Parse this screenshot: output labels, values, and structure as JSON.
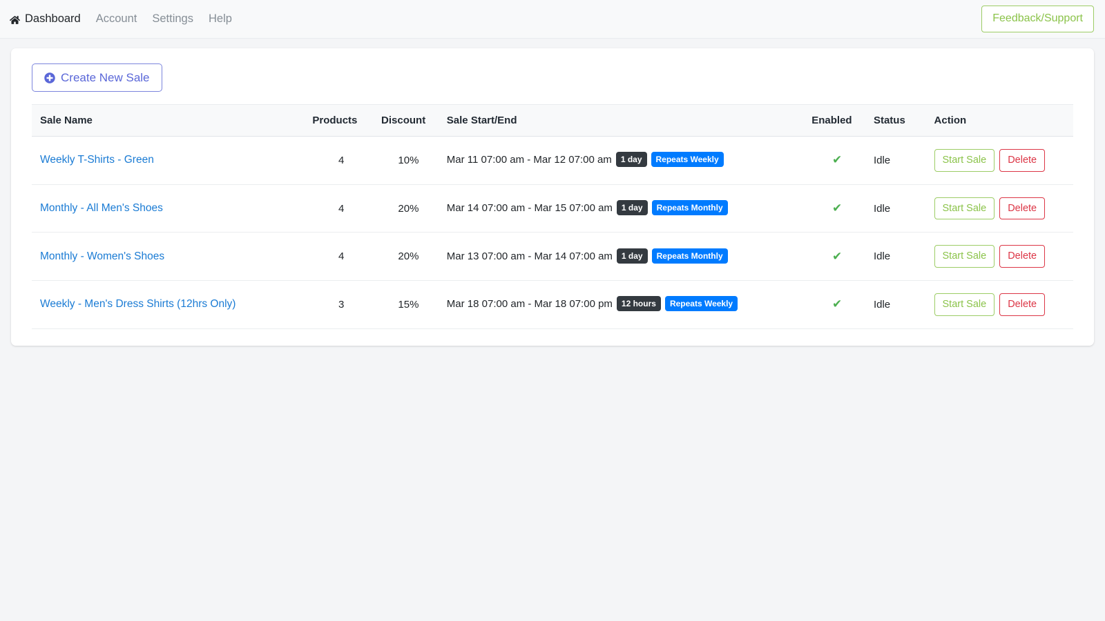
{
  "navbar": {
    "brand": {
      "icon": "home-icon",
      "label": "Dashboard"
    },
    "links": [
      {
        "label": "Account"
      },
      {
        "label": "Settings"
      },
      {
        "label": "Help"
      }
    ],
    "feedback_button": {
      "label": "Feedback/Support",
      "color": "#8bc34a"
    }
  },
  "toolbar": {
    "create_label": "Create New Sale",
    "create_icon": "plus-circle-icon",
    "create_color": "#5a67d8"
  },
  "table": {
    "headers": {
      "name": "Sale Name",
      "products": "Products",
      "discount": "Discount",
      "dates": "Sale Start/End",
      "enabled": "Enabled",
      "status": "Status",
      "action": "Action"
    },
    "row_actions": {
      "start_label": "Start Sale",
      "delete_label": "Delete",
      "start_color": "#8bc34a",
      "delete_color": "#dc3545"
    },
    "enabled_icon": "check-icon",
    "enabled_color": "#4caf50",
    "badge_colors": {
      "duration": "#343a40",
      "repeat": "#007bff"
    },
    "rows": [
      {
        "name": "Weekly T-Shirts - Green",
        "products": "4",
        "discount": "10%",
        "dates": "Mar 11 07:00 am - Mar 12 07:00 am",
        "duration_badge": "1 day",
        "repeat_badge": "Repeats Weekly",
        "enabled": "✔",
        "status": "Idle",
        "start_label": "Start Sale",
        "delete_label": "Delete"
      },
      {
        "name": "Monthly - All Men's Shoes",
        "products": "4",
        "discount": "20%",
        "dates": "Mar 14 07:00 am - Mar 15 07:00 am",
        "duration_badge": "1 day",
        "repeat_badge": "Repeats Monthly",
        "enabled": "✔",
        "status": "Idle",
        "start_label": "Start Sale",
        "delete_label": "Delete"
      },
      {
        "name": "Monthly - Women's Shoes",
        "products": "4",
        "discount": "20%",
        "dates": "Mar 13 07:00 am - Mar 14 07:00 am",
        "duration_badge": "1 day",
        "repeat_badge": "Repeats Monthly",
        "enabled": "✔",
        "status": "Idle",
        "start_label": "Start Sale",
        "delete_label": "Delete"
      },
      {
        "name": "Weekly - Men's Dress Shirts (12hrs Only)",
        "products": "3",
        "discount": "15%",
        "dates": "Mar 18 07:00 am - Mar 18 07:00 pm",
        "duration_badge": "12 hours",
        "repeat_badge": "Repeats Weekly",
        "enabled": "✔",
        "status": "Idle",
        "start_label": "Start Sale",
        "delete_label": "Delete"
      }
    ]
  }
}
